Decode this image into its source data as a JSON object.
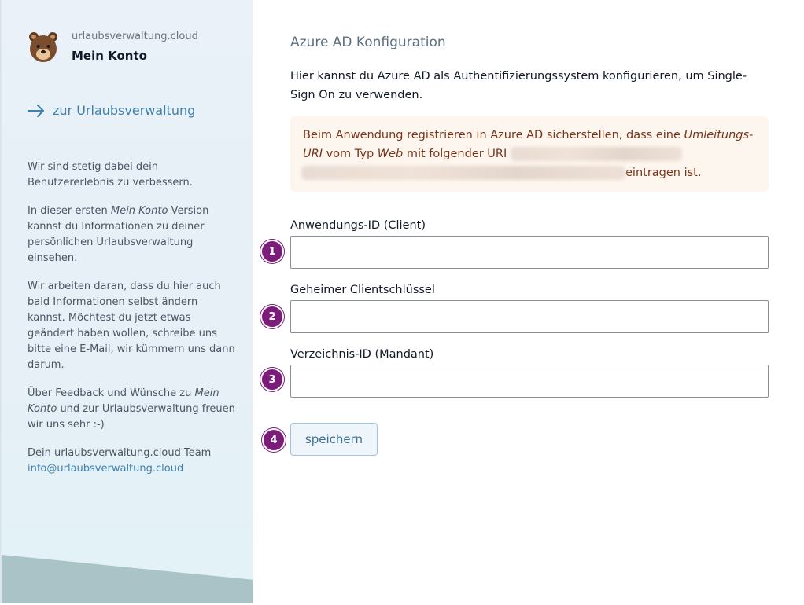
{
  "sidebar": {
    "brand_domain": "urlaubsverwaltung.cloud",
    "brand_title": "Mein Konto",
    "back_link": "zur Urlaubsverwaltung",
    "p1": "Wir sind stetig dabei dein Benutzererlebnis zu verbessern.",
    "p2_before": "In dieser ersten ",
    "p2_em": "Mein Konto",
    "p2_after": " Version kannst du Informationen zu deiner persönlichen Urlaubsverwaltung einsehen.",
    "p3": "Wir arbeiten daran, dass du hier auch bald Informationen selbst ändern kannst. Möchtest du jetzt etwas geändert haben wollen, schreibe uns bitte eine E-Mail, wir kümmern uns dann darum.",
    "p4_before": "Über Feedback und Wünsche zu ",
    "p4_em": "Mein Konto",
    "p4_after": " und zur Urlaubsverwaltung freuen wir uns sehr :-)",
    "team": "Dein urlaubsverwaltung.cloud Team",
    "email": "info@urlaubsverwaltung.cloud"
  },
  "main": {
    "title": "Azure AD Konfiguration",
    "intro": "Hier kannst du Azure AD als Authentifizierungssystem konfigurieren, um Single-Sign On zu verwenden.",
    "notice_1": "Beim Anwendung registrieren in Azure AD sicherstellen, dass eine ",
    "notice_em1": "Umleitungs-URI",
    "notice_2": " vom Typ ",
    "notice_em2": "Web",
    "notice_3": " mit folgender URI ",
    "notice_4": "eintragen ist.",
    "fields": [
      {
        "label": "Anwendungs-ID (Client)",
        "value": ""
      },
      {
        "label": "Geheimer Clientschlüssel",
        "value": ""
      },
      {
        "label": "Verzeichnis-ID (Mandant)",
        "value": ""
      }
    ],
    "save_label": "speichern"
  },
  "steps": [
    "1",
    "2",
    "3",
    "4"
  ],
  "colors": {
    "accent": "#3f80ad",
    "step_badge": "#7b1b7a",
    "notice_bg": "#fdf6ef",
    "notice_text": "#7a3418"
  }
}
